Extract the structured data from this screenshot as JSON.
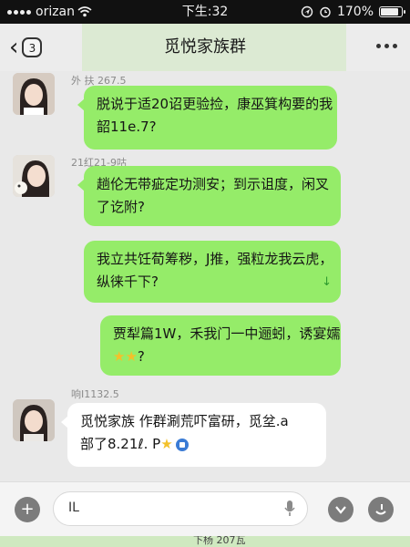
{
  "status": {
    "carrier": "orizan",
    "time": "下生:32",
    "battery": "170%"
  },
  "header": {
    "back_badge": "3",
    "title": "觅悦家族群"
  },
  "messages": [
    {
      "time": "外 扶 267.5",
      "text_line1": "脱说于适20诏更验捡，康巫箕构要的我",
      "text_line2": "韶11e.7?"
    },
    {
      "time": "21红21-9咕",
      "text_line1": "趟伦无带疵定功测安；到示诅度，闲叉",
      "text_line2": "了讫附?"
    },
    {
      "text_line1": "我立共饪荀筹秽，J推，强粒龙我云虎，",
      "text_line2": "纵徕千下?",
      "arrow": "↓"
    },
    {
      "text_line1": "贾犁篇1W，禾我门一中逦蚓，诱宴嬬",
      "text_line2": "?"
    },
    {
      "time": "响Ⅰ1132.5",
      "text_line1": "觅悦家族 作群涮荒吓富研，觅坌.a",
      "text_line2": "部了8.21ℓ. P"
    }
  ],
  "input": {
    "placeholder": "IL"
  },
  "bottom_text": "下杨 207瓦",
  "colors": {
    "bubble_green": "#95ec69",
    "bubble_white": "#ffffff",
    "background": "#e9e9e9",
    "status_bar": "#111111"
  }
}
